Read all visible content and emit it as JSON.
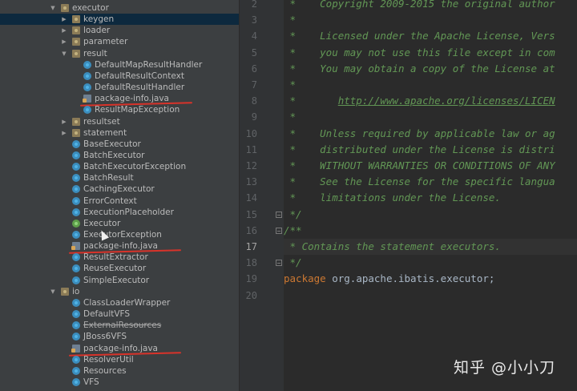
{
  "project_tree": {
    "items": [
      {
        "label": "executor",
        "type": "folder",
        "depth": 0,
        "expanded": true
      },
      {
        "label": "keygen",
        "type": "folder",
        "depth": 1,
        "expanded": false,
        "selected": true
      },
      {
        "label": "loader",
        "type": "folder",
        "depth": 1,
        "expanded": false
      },
      {
        "label": "parameter",
        "type": "folder",
        "depth": 1,
        "expanded": false
      },
      {
        "label": "result",
        "type": "folder",
        "depth": 1,
        "expanded": true
      },
      {
        "label": "DefaultMapResultHandler",
        "type": "class",
        "depth": 2
      },
      {
        "label": "DefaultResultContext",
        "type": "class",
        "depth": 2
      },
      {
        "label": "DefaultResultHandler",
        "type": "class",
        "depth": 2
      },
      {
        "label": "package-info.java",
        "type": "file",
        "depth": 2,
        "underlined": true
      },
      {
        "label": "ResultMapException",
        "type": "class",
        "depth": 2
      },
      {
        "label": "resultset",
        "type": "folder",
        "depth": 1,
        "expanded": false
      },
      {
        "label": "statement",
        "type": "folder",
        "depth": 1,
        "expanded": false
      },
      {
        "label": "BaseExecutor",
        "type": "class",
        "depth": 1
      },
      {
        "label": "BatchExecutor",
        "type": "class",
        "depth": 1
      },
      {
        "label": "BatchExecutorException",
        "type": "class",
        "depth": 1
      },
      {
        "label": "BatchResult",
        "type": "class",
        "depth": 1
      },
      {
        "label": "CachingExecutor",
        "type": "class",
        "depth": 1
      },
      {
        "label": "ErrorContext",
        "type": "class",
        "depth": 1
      },
      {
        "label": "ExecutionPlaceholder",
        "type": "class",
        "depth": 1
      },
      {
        "label": "Executor",
        "type": "interface",
        "depth": 1
      },
      {
        "label": "ExecutorException",
        "type": "class",
        "depth": 1
      },
      {
        "label": "package-info.java",
        "type": "file",
        "depth": 1,
        "underlined": true
      },
      {
        "label": "ResultExtractor",
        "type": "class",
        "depth": 1
      },
      {
        "label": "ReuseExecutor",
        "type": "class",
        "depth": 1
      },
      {
        "label": "SimpleExecutor",
        "type": "class",
        "depth": 1
      },
      {
        "label": "io",
        "type": "folder",
        "depth": 0,
        "expanded": true
      },
      {
        "label": "ClassLoaderWrapper",
        "type": "class",
        "depth": 1
      },
      {
        "label": "DefaultVFS",
        "type": "class",
        "depth": 1
      },
      {
        "label": "ExternalResources",
        "type": "class",
        "depth": 1,
        "strikethrough": true
      },
      {
        "label": "JBoss6VFS",
        "type": "class",
        "depth": 1
      },
      {
        "label": "package-info.java",
        "type": "file",
        "depth": 1,
        "underlined": true
      },
      {
        "label": "ResolverUtil",
        "type": "class",
        "depth": 1
      },
      {
        "label": "Resources",
        "type": "class",
        "depth": 1
      },
      {
        "label": "VFS",
        "type": "class",
        "depth": 1
      }
    ]
  },
  "editor": {
    "current_line": 17,
    "lines": [
      {
        "n": "2",
        "text": " *    Copyright 2009-2015 the original author"
      },
      {
        "n": "3",
        "text": " *"
      },
      {
        "n": "4",
        "text": " *    Licensed under the Apache License, Vers"
      },
      {
        "n": "5",
        "text": " *    you may not use this file except in com"
      },
      {
        "n": "6",
        "text": " *    You may obtain a copy of the License at"
      },
      {
        "n": "7",
        "text": " *"
      },
      {
        "n": "8",
        "text": " *       ",
        "link": "http://www.apache.org/licenses/LICEN"
      },
      {
        "n": "9",
        "text": " *"
      },
      {
        "n": "10",
        "text": " *    Unless required by applicable law or ag"
      },
      {
        "n": "11",
        "text": " *    distributed under the License is distri"
      },
      {
        "n": "12",
        "text": " *    WITHOUT WARRANTIES OR CONDITIONS OF ANY"
      },
      {
        "n": "13",
        "text": " *    See the License for the specific langua"
      },
      {
        "n": "14",
        "text": " *    limitations under the License."
      },
      {
        "n": "15",
        "text": " */"
      },
      {
        "n": "16",
        "text": "/**"
      },
      {
        "n": "17",
        "text": " * Contains the statement executors."
      },
      {
        "n": "18",
        "text": " */"
      },
      {
        "n": "19",
        "keyword": "package",
        "text": " org.apache.ibatis.executor;"
      },
      {
        "n": "20",
        "text": ""
      }
    ]
  },
  "watermark": "知乎 @小小刀"
}
